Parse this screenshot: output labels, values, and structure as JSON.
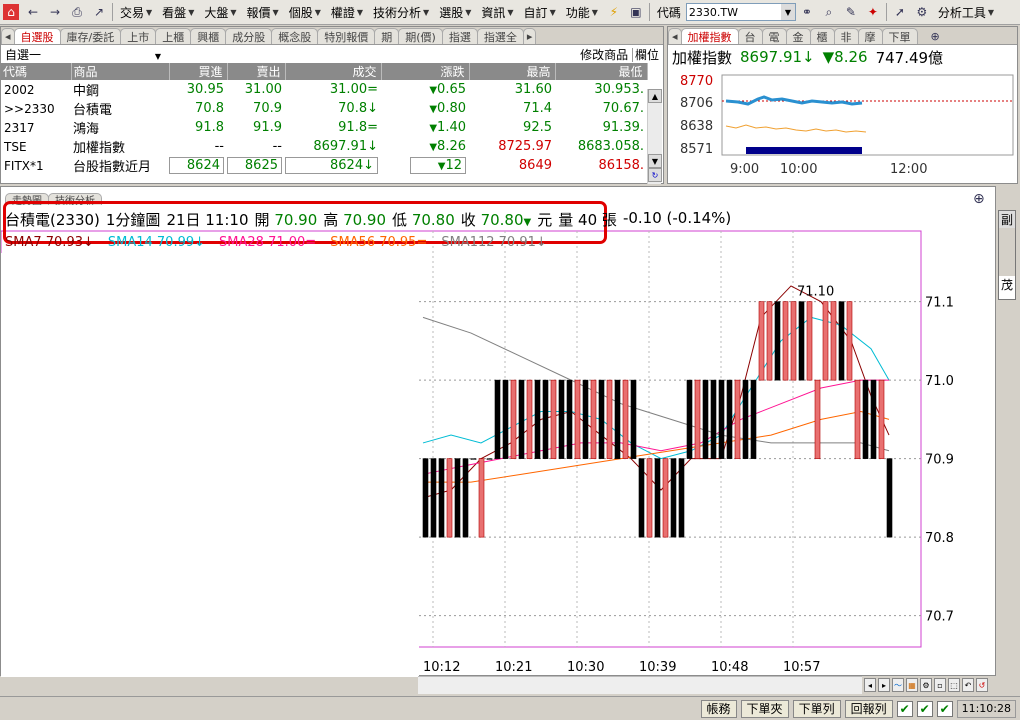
{
  "toolbar": {
    "menus": [
      "交易",
      "看盤",
      "大盤",
      "報價",
      "個股",
      "權證",
      "技術分析",
      "選股",
      "資訊",
      "自訂",
      "功能"
    ],
    "code_label": "代碼",
    "code_value": "2330.TW",
    "analysis_label": "分析工具"
  },
  "watchlist": {
    "tabs": [
      "自選股",
      "庫存/委託",
      "上市",
      "上櫃",
      "興櫃",
      "成分股",
      "概念股",
      "特別報價",
      "期",
      "期(價)",
      "指選",
      "指選全"
    ],
    "group_name": "自選一",
    "edit_label": "修改商品",
    "column_label": "欄位",
    "columns": [
      "代碼",
      "商品",
      "買進",
      "賣出",
      "成交",
      "漲跌",
      "最高",
      "最低"
    ],
    "rows": [
      {
        "code": "2002",
        "name": "中鋼",
        "bid": "30.95",
        "ask": "31.00",
        "last": "31.00=",
        "chg": "0.65",
        "high": "31.60",
        "low": "30.953."
      },
      {
        "code": ">>2330",
        "name": "台積電",
        "bid": "70.8",
        "ask": "70.9",
        "last": "70.8↓",
        "chg": "0.80",
        "high": "71.4",
        "low": "70.67."
      },
      {
        "code": "2317",
        "name": "鴻海",
        "bid": "91.8",
        "ask": "91.9",
        "last": "91.8=",
        "chg": "1.40",
        "high": "92.5",
        "low": "91.39."
      },
      {
        "code": "TSE",
        "name": "加權指數",
        "bid": "--",
        "ask": "--",
        "last": "8697.91↓",
        "chg": "8.26",
        "high": "8725.97",
        "low": "8683.058."
      },
      {
        "code": "FITX*1",
        "name": "台股指數近月",
        "bid": "8624",
        "ask": "8625",
        "last": "8624↓",
        "chg": "12",
        "high": "8649",
        "low": "86158."
      }
    ]
  },
  "index_panel": {
    "tabs": [
      "加權指數",
      "台",
      "電",
      "金",
      "櫃",
      "非",
      "摩",
      "下單"
    ],
    "name": "加權指數",
    "value": "8697.91↓",
    "change": "▼8.26",
    "volume": "747.49億",
    "y_labels": [
      "8770",
      "8706",
      "8638",
      "8571"
    ],
    "x_labels": [
      "9:00",
      "10:00",
      "12:00"
    ]
  },
  "chart": {
    "tabs": [
      "走勢圖",
      "技術分析"
    ],
    "quote": {
      "stock": "台積電(2330)",
      "period": "1分鐘圖",
      "datetime": "21日 11:10",
      "open_label": "開",
      "open": "70.90",
      "high_label": "高",
      "high": "70.90",
      "low_label": "低",
      "low": "70.80",
      "close_label": "收",
      "close": "70.80",
      "unit": "元",
      "vol_label": "量",
      "vol": "40",
      "vol_unit": "張",
      "change": "-0.10 (-0.14%)"
    },
    "sma": [
      {
        "text": "SMA7 70.93↓",
        "color": "#8b0000"
      },
      {
        "text": "SMA14 70.99↓",
        "color": "#00bcd4"
      },
      {
        "text": "SMA28 71.00=",
        "color": "#ff1493"
      },
      {
        "text": "SMA56 70.95=",
        "color": "#ff6600"
      },
      {
        "text": "SMA112 70.91↓",
        "color": "#808080"
      }
    ],
    "high_marker": "71.10",
    "right_strip": [
      "副",
      "茂"
    ]
  },
  "chart_data": {
    "type": "candlestick",
    "x_ticks": [
      "10:12",
      "10:21",
      "10:30",
      "10:39",
      "10:48",
      "10:57"
    ],
    "y_ticks": [
      71.1,
      71.0,
      70.9,
      70.8,
      70.7
    ],
    "ylim": [
      70.66,
      71.19
    ]
  },
  "bottom": {
    "buttons": [
      "帳務",
      "下單夾",
      "下單列",
      "回報列"
    ],
    "time": "11:10:28"
  }
}
